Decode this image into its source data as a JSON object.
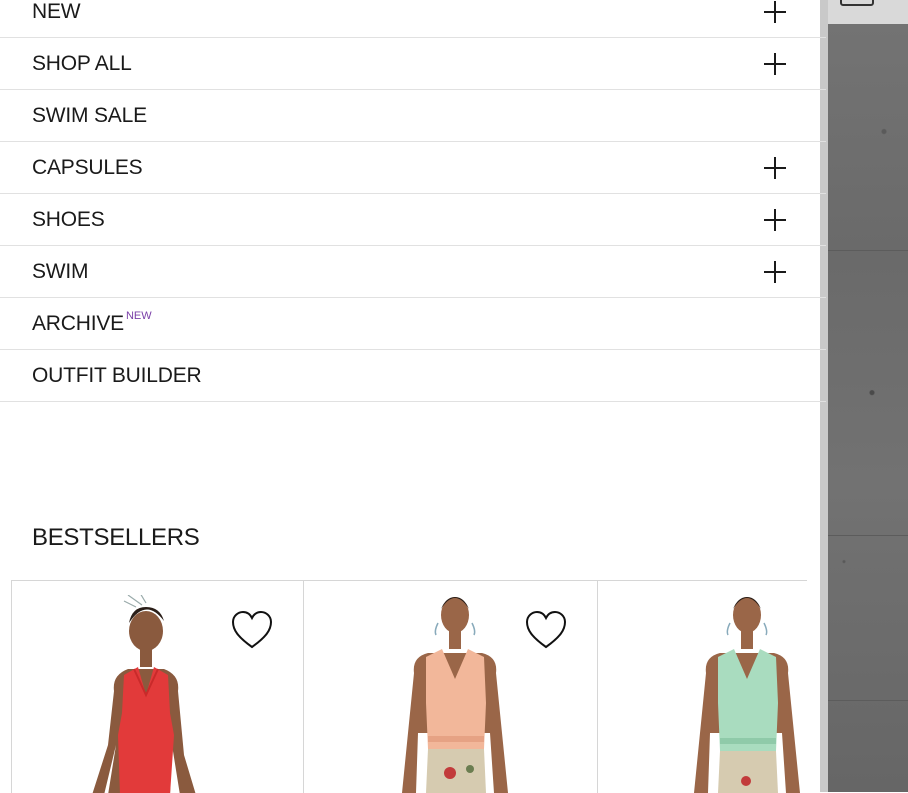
{
  "menu": {
    "items": [
      {
        "label": "NEW",
        "expandable": true
      },
      {
        "label": "SHOP ALL",
        "expandable": true
      },
      {
        "label": "SWIM SALE",
        "expandable": false
      },
      {
        "label": "CAPSULES",
        "expandable": true
      },
      {
        "label": "SHOES",
        "expandable": true
      },
      {
        "label": "SWIM",
        "expandable": true
      },
      {
        "label": "ARCHIVE",
        "badge": "NEW",
        "expandable": false
      },
      {
        "label": "OUTFIT BUILDER",
        "expandable": false
      }
    ],
    "expand_icon": "plus-icon"
  },
  "bestsellers": {
    "title": "BESTSELLERS",
    "products": [
      {
        "color": "#e23a3a",
        "wishlist_icon": "heart-outline-icon"
      },
      {
        "color": "#f2b79a",
        "wishlist_icon": "heart-outline-icon"
      },
      {
        "color": "#a9dcbf",
        "wishlist_icon": "heart-outline-icon"
      }
    ]
  },
  "colors": {
    "badge": "#7a3fa8",
    "divider": "#e1e1e1",
    "text": "#1a1a1a"
  }
}
